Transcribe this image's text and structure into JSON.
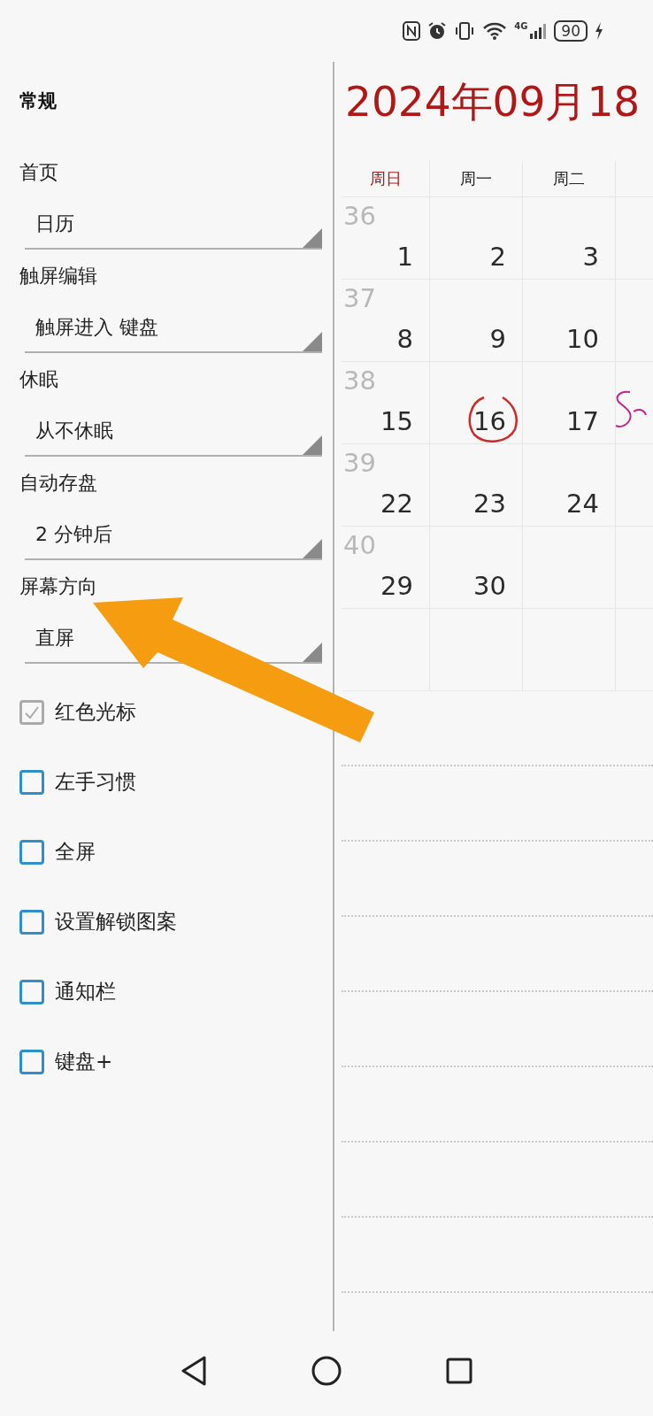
{
  "status_bar": {
    "network": "4G",
    "battery": "90"
  },
  "settings": {
    "title": "常规",
    "dropdowns": [
      {
        "label": "首页",
        "value": "日历"
      },
      {
        "label": "触屏编辑",
        "value": "触屏进入 键盘"
      },
      {
        "label": "休眠",
        "value": "从不休眠"
      },
      {
        "label": "自动存盘",
        "value": "2 分钟后"
      },
      {
        "label": "屏幕方向",
        "value": "直屏"
      }
    ],
    "checkboxes": [
      {
        "label": "红色光标",
        "checked": true
      },
      {
        "label": "左手习惯",
        "checked": false
      },
      {
        "label": "全屏",
        "checked": false
      },
      {
        "label": "设置解锁图案",
        "checked": false
      },
      {
        "label": "通知栏",
        "checked": false
      },
      {
        "label": "键盘+",
        "checked": false
      }
    ]
  },
  "calendar": {
    "title": "2024年09月18",
    "weekdays": [
      {
        "label": "周日",
        "kind": "holiday"
      },
      {
        "label": "周一",
        "kind": "workday"
      },
      {
        "label": "周二",
        "kind": "workday"
      }
    ],
    "weeks": [
      {
        "number": "36",
        "handwriting": false,
        "days": [
          {
            "text": "1",
            "circled": false
          },
          {
            "text": "2",
            "circled": false
          },
          {
            "text": "3",
            "circled": false
          }
        ]
      },
      {
        "number": "37",
        "handwriting": false,
        "days": [
          {
            "text": "8",
            "circled": false
          },
          {
            "text": "9",
            "circled": false
          },
          {
            "text": "10",
            "circled": false
          }
        ]
      },
      {
        "number": "38",
        "handwriting": true,
        "days": [
          {
            "text": "15",
            "circled": false
          },
          {
            "text": "16",
            "circled": true
          },
          {
            "text": "17",
            "circled": false
          }
        ]
      },
      {
        "number": "39",
        "handwriting": false,
        "days": [
          {
            "text": "22",
            "circled": false
          },
          {
            "text": "23",
            "circled": false
          },
          {
            "text": "24",
            "circled": false
          }
        ]
      },
      {
        "number": "40",
        "handwriting": false,
        "days": [
          {
            "text": "29",
            "circled": false
          },
          {
            "text": "30",
            "circled": false
          }
        ]
      }
    ]
  }
}
